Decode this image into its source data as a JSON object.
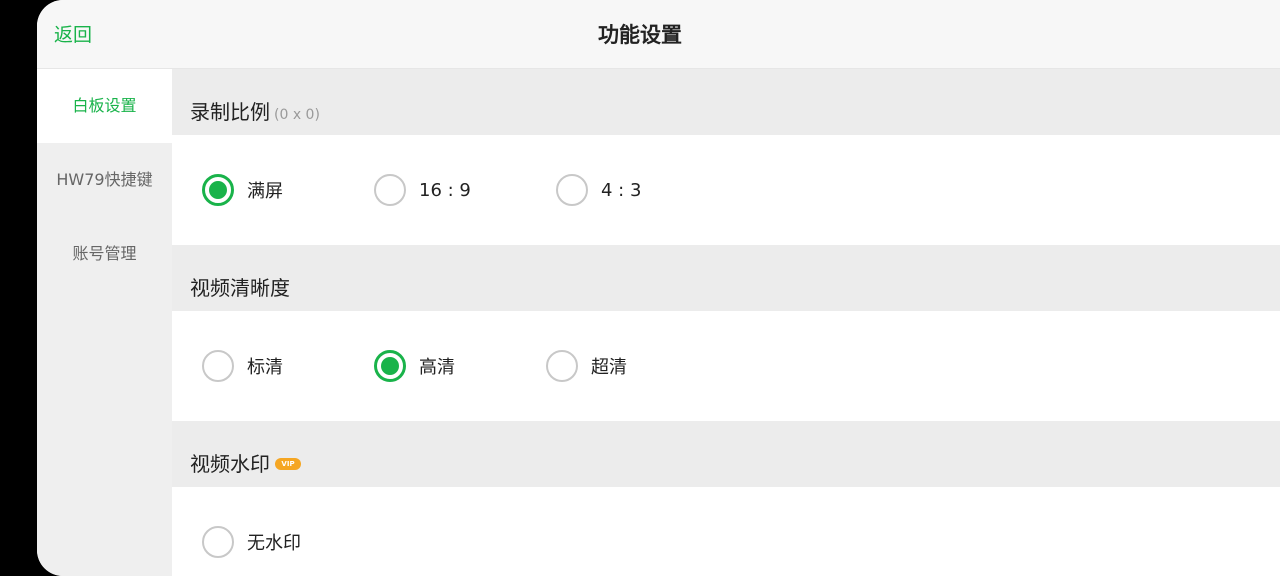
{
  "header": {
    "back_label": "返回",
    "title": "功能设置"
  },
  "sidebar": {
    "items": [
      {
        "label": "白板设置",
        "active": true
      },
      {
        "label": "HW79快捷键",
        "active": false
      },
      {
        "label": "账号管理",
        "active": false
      }
    ]
  },
  "sections": [
    {
      "title": "录制比例",
      "subtitle": "(0 x 0)",
      "options": [
        {
          "label": "满屏",
          "checked": true
        },
        {
          "label": "16 : 9",
          "checked": false
        },
        {
          "label": "4 : 3",
          "checked": false
        }
      ]
    },
    {
      "title": "视频清晰度",
      "options": [
        {
          "label": "标清",
          "checked": false
        },
        {
          "label": "高清",
          "checked": true
        },
        {
          "label": "超清",
          "checked": false
        }
      ]
    },
    {
      "title": "视频水印",
      "badge": "VIP",
      "options": [
        {
          "label": "无水印",
          "checked": false
        }
      ]
    }
  ],
  "colors": {
    "accent": "#19b34a",
    "badge": "#f5a623"
  }
}
